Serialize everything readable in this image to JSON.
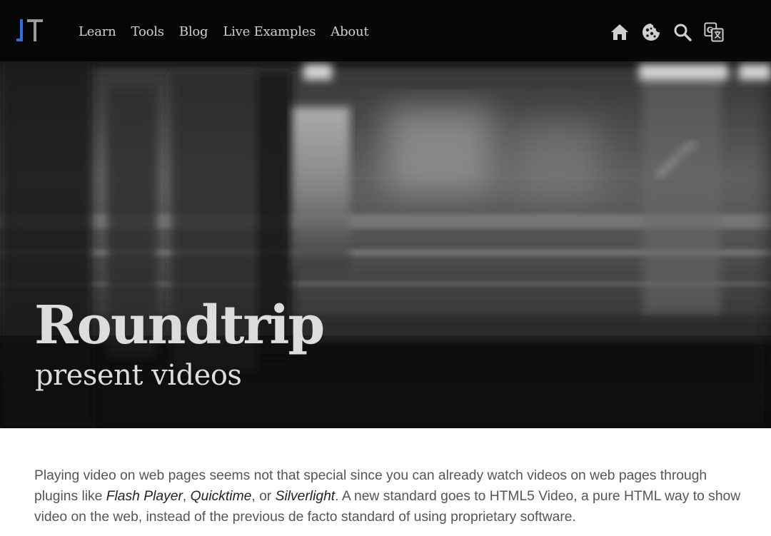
{
  "nav": {
    "links": [
      {
        "label": "Learn"
      },
      {
        "label": "Tools"
      },
      {
        "label": "Blog"
      },
      {
        "label": "Live Examples"
      },
      {
        "label": "About"
      }
    ],
    "icons": [
      {
        "name": "home-icon"
      },
      {
        "name": "cookie-icon"
      },
      {
        "name": "search-icon"
      },
      {
        "name": "translate-icon"
      }
    ]
  },
  "hero": {
    "title": "Roundtrip",
    "subtitle": "present videos"
  },
  "content": {
    "intro_1": "Playing video on web pages seems not that special since you can already watch videos on web pages through plugins like ",
    "plugin_1": "Flash Player",
    "sep_1": ", ",
    "plugin_2": "Quicktime",
    "sep_2": ", or ",
    "plugin_3": "Silverlight",
    "intro_2": ". A new standard goes to HTML5 Video, a pure HTML way to show video on the web, instead of the previous de facto standard of using proprietary software."
  },
  "colors": {
    "logo_blue": "#2f6fdb",
    "nav_text": "#d0d0d0",
    "hero_text": "#dcdcdc",
    "body_text": "#555555"
  }
}
